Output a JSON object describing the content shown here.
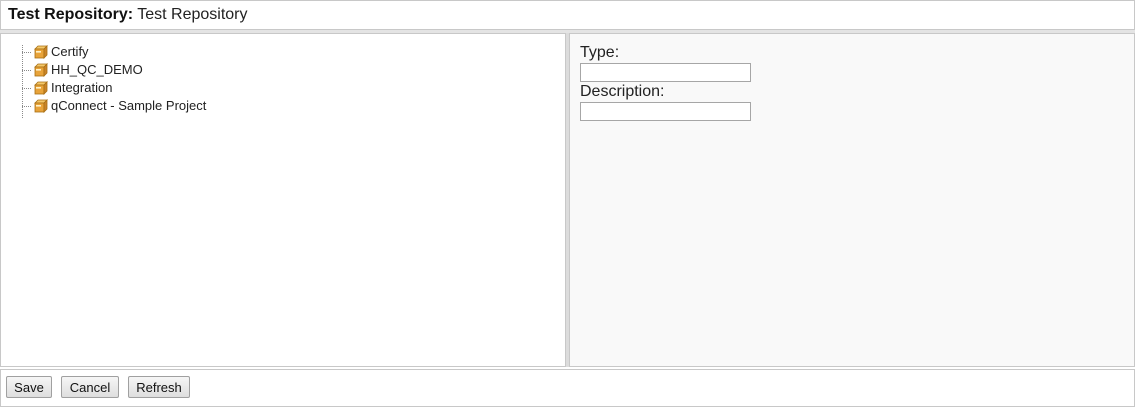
{
  "header": {
    "label": "Test Repository:",
    "value": "Test Repository"
  },
  "tree": {
    "items": [
      {
        "label": "Certify",
        "icon": "project-box-icon"
      },
      {
        "label": "HH_QC_DEMO",
        "icon": "project-box-icon"
      },
      {
        "label": "Integration",
        "icon": "project-box-icon"
      },
      {
        "label": "qConnect - Sample Project",
        "icon": "project-box-icon"
      }
    ]
  },
  "details": {
    "type_label": "Type:",
    "type_value": "",
    "description_label": "Description:",
    "description_value": ""
  },
  "footer": {
    "save_label": "Save",
    "cancel_label": "Cancel",
    "refresh_label": "Refresh"
  },
  "colors": {
    "border": "#c8c8c8",
    "detail_background": "#f9f9f9",
    "icon_orange": "#e8a33a"
  }
}
